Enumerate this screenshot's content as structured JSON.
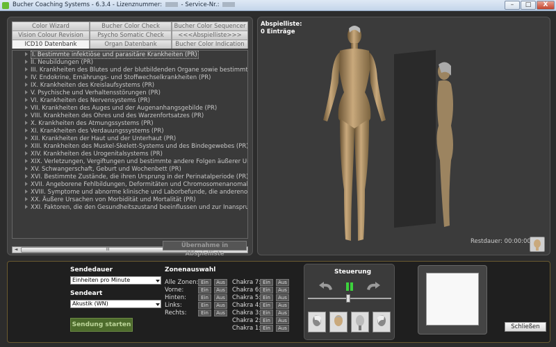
{
  "window": {
    "app_name": "Bucher Coaching Systems",
    "version": "6.3.4",
    "license_label": "Lizenznummer:",
    "service_label": "Service-Nr.:",
    "min_label": "–",
    "max_label": "□",
    "close_label": "X"
  },
  "tabs": {
    "row1": [
      "Color Wizard",
      "Bucher Color Check",
      "Bucher Color Sequencer"
    ],
    "row2": [
      "Vision Colour Revision",
      "Psycho Somatic Check",
      "<<<Abspielliste>>>"
    ],
    "row3": [
      "ICD10 Datenbank",
      "Organ Datenbank",
      "Bucher Color Indication"
    ]
  },
  "tree_items": [
    "I. Bestimmte infektiöse und parasitäre Krankheiten (PR)",
    "II. Neubildungen (PR)",
    "III. Krankheiten des Blutes und der blutbildenden Organe sowie bestimmte Störung",
    "IV. Endokrine, Ernährungs- und Stoffwechselkrankheiten (PR)",
    "IX. Krankheiten des Kreislaufsystems (PR)",
    "V. Psychische und Verhaltensstörungen (PR)",
    "VI. Krankheiten des Nervensystems (PR)",
    "VII. Krankheiten des Auges und der Augenanhangsgebilde (PR)",
    "VIII. Krankheiten des Ohres und des Warzenfortsatzes (PR)",
    "X. Krankheiten des Atmungssystems (PR)",
    "XI. Krankheiten des Verdauungssystems (PR)",
    "XII. Krankheiten der Haut und der Unterhaut (PR)",
    "XIII. Krankheiten des Muskel-Skelett-Systems und des Bindegewebes (PR)",
    "XIV. Krankheiten des Urogenitalsystems (PR)",
    "XIX. Verletzungen, Vergiftungen und bestimmte andere Folgen äußerer Ursachen (F",
    "XV. Schwangerschaft, Geburt und Wochenbett (PR)",
    "XVI. Bestimmte Zustände, die ihren Ursprung in der Perinatalperiode (PR) haben",
    "XVII. Angeborene Fehlbildungen, Deformitäten und Chromosomenanomalien (PR)",
    "XVIII. Symptome und abnorme klinische und Laborbefunde, die anderenorts nicht k",
    "XX. Äußere Ursachen von Morbidität und Mortalität (PR)",
    "XXI. Faktoren, die den Gesundheitszustand beeinflussen und zur Inanspruchnahme"
  ],
  "scrollbar": {
    "left": "◄",
    "right": "►",
    "grip": "III"
  },
  "uebernahme_label": "Übernahme in Abspielliste",
  "abspielliste": {
    "title": "Abspielliste:",
    "count": "0 Einträge"
  },
  "restdauer": "Restdauer: 00:00:00",
  "controls": {
    "sendedauer_label": "Sendedauer",
    "sendedauer_value": "Einheiten pro Minute",
    "sendeart_label": "Sendeart",
    "sendeart_value": "Akustik (WN)",
    "send_button": "Sendung starten",
    "zonen_label": "Zonenauswahl",
    "zones": [
      "Alle Zonen:",
      "Vorne:",
      "Hinten:",
      "Links:",
      "Rechts:"
    ],
    "chakras": [
      "Chakra 7:",
      "Chakra 6:",
      "Chakra 5:",
      "Chakra 4:",
      "Chakra 3:",
      "Chakra 2:",
      "Chakra 1:"
    ],
    "ein": "Ein",
    "aus": "Aus",
    "steuerung_label": "Steuerung",
    "close_button": "Schließen"
  },
  "colors": {
    "accent_green": "#4d6b2c",
    "play_green": "#3cd23c"
  }
}
